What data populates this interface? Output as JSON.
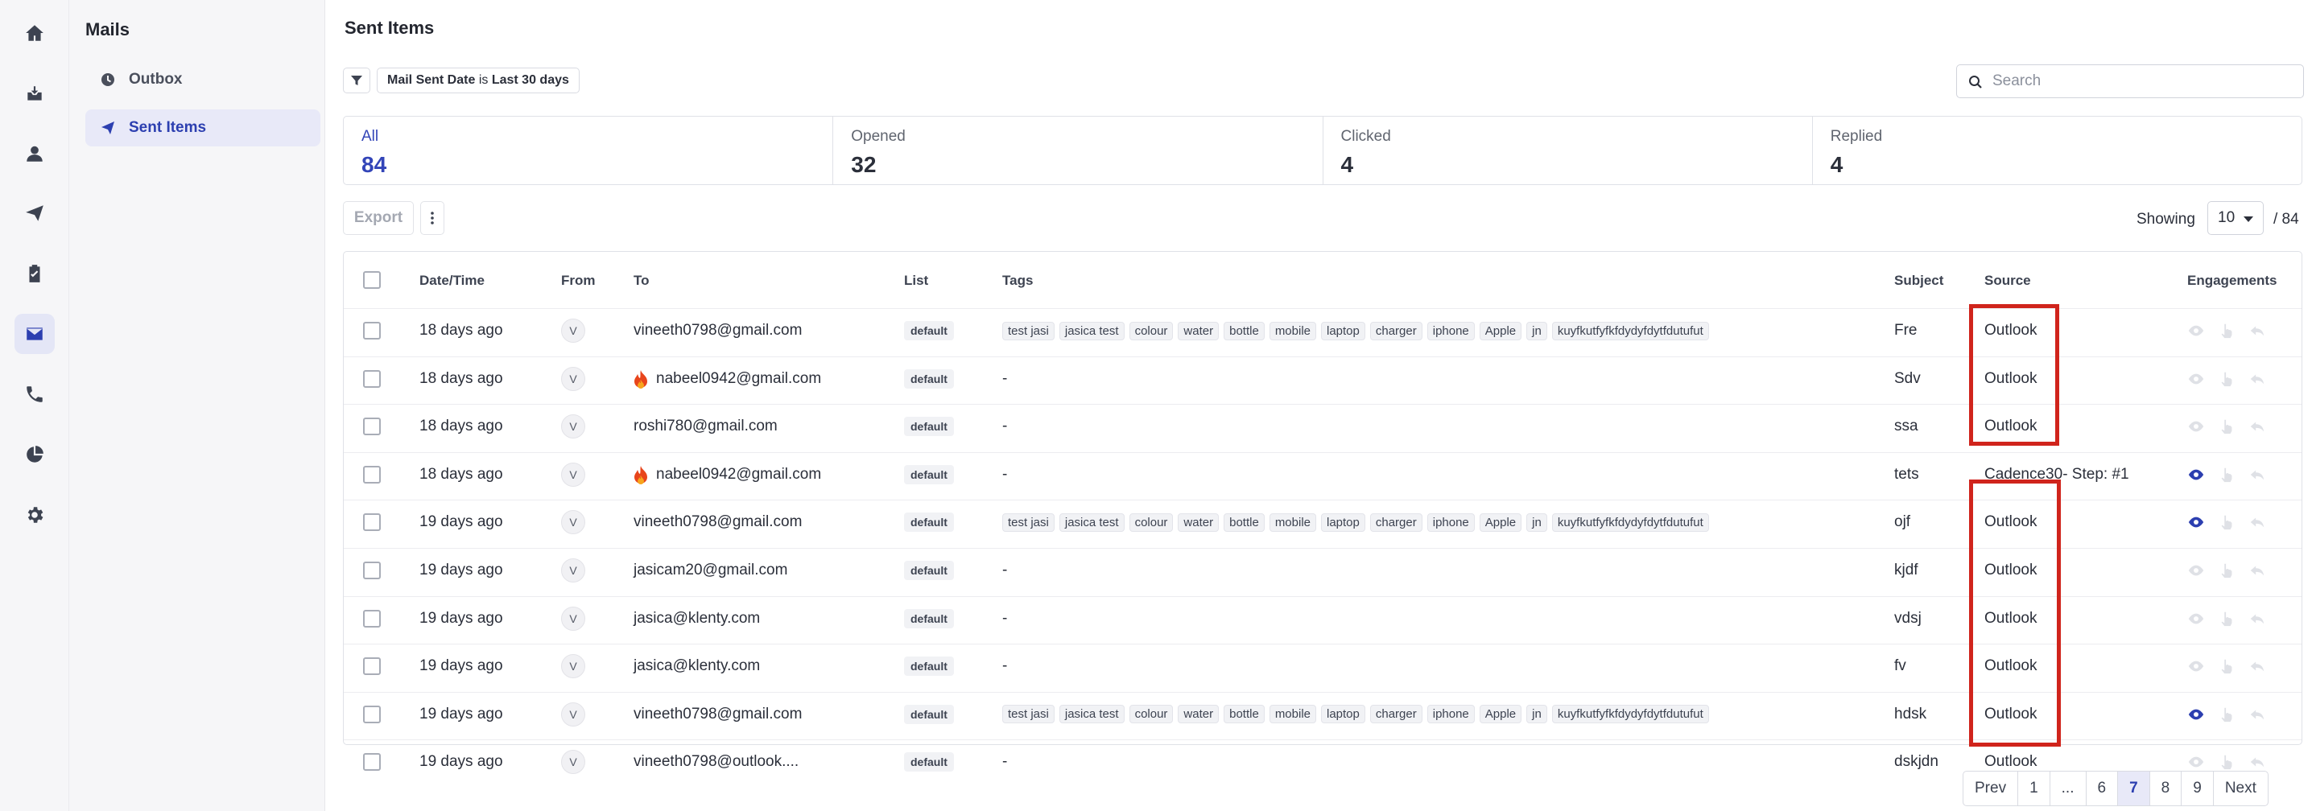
{
  "nav": {
    "icons": [
      "home-icon",
      "inbox-icon",
      "contacts-icon",
      "campaigns-icon",
      "tasks-icon",
      "mail-icon",
      "phone-icon",
      "reports-icon",
      "settings-icon"
    ],
    "active": "mail-icon"
  },
  "subnav": {
    "title": "Mails",
    "items": [
      {
        "label": "Outbox",
        "icon": "clock-icon"
      },
      {
        "label": "Sent Items",
        "icon": "send-icon"
      }
    ]
  },
  "page": {
    "title": "Sent Items"
  },
  "filter": {
    "field": "Mail Sent Date",
    "op": "is",
    "value": "Last 30 days"
  },
  "search": {
    "placeholder": "Search"
  },
  "stats": [
    {
      "label": "All",
      "value": "84"
    },
    {
      "label": "Opened",
      "value": "32"
    },
    {
      "label": "Clicked",
      "value": "4"
    },
    {
      "label": "Replied",
      "value": "4"
    }
  ],
  "toolbar": {
    "export_label": "Export",
    "showing_label": "Showing",
    "page_size": "10",
    "total": "/ 84"
  },
  "table": {
    "headers": [
      "Date/Time",
      "From",
      "To",
      "List",
      "Tags",
      "Subject",
      "Source",
      "Engagements"
    ],
    "tag_set": [
      "test jasi",
      "jasica test",
      "colour",
      "water",
      "bottle",
      "mobile",
      "laptop",
      "charger",
      "iphone",
      "Apple",
      "jn",
      "kuyfkutfyfkfdydyfdytfdutufut"
    ],
    "rows": [
      {
        "date": "18 days ago",
        "from": "V",
        "to": "vineeth0798@gmail.com",
        "fire": false,
        "list": "default",
        "tags": true,
        "no_tags": "",
        "subject": "Fre",
        "source": "Outlook",
        "opened": false
      },
      {
        "date": "18 days ago",
        "from": "V",
        "to": "nabeel0942@gmail.com",
        "fire": true,
        "list": "default",
        "tags": false,
        "no_tags": "-",
        "subject": "Sdv",
        "source": "Outlook",
        "opened": false
      },
      {
        "date": "18 days ago",
        "from": "V",
        "to": "roshi780@gmail.com",
        "fire": false,
        "list": "default",
        "tags": false,
        "no_tags": "-",
        "subject": "ssa",
        "source": "Outlook",
        "opened": false
      },
      {
        "date": "18 days ago",
        "from": "V",
        "to": "nabeel0942@gmail.com",
        "fire": true,
        "list": "default",
        "tags": false,
        "no_tags": "-",
        "subject": "tets",
        "source": "Cadence30- Step: #1",
        "opened": true
      },
      {
        "date": "19 days ago",
        "from": "V",
        "to": "vineeth0798@gmail.com",
        "fire": false,
        "list": "default",
        "tags": true,
        "no_tags": "",
        "subject": "ojf",
        "source": "Outlook",
        "opened": true
      },
      {
        "date": "19 days ago",
        "from": "V",
        "to": "jasicam20@gmail.com",
        "fire": false,
        "list": "default",
        "tags": false,
        "no_tags": "-",
        "subject": "kjdf",
        "source": "Outlook",
        "opened": false
      },
      {
        "date": "19 days ago",
        "from": "V",
        "to": "jasica@klenty.com",
        "fire": false,
        "list": "default",
        "tags": false,
        "no_tags": "-",
        "subject": "vdsj",
        "source": "Outlook",
        "opened": false
      },
      {
        "date": "19 days ago",
        "from": "V",
        "to": "jasica@klenty.com",
        "fire": false,
        "list": "default",
        "tags": false,
        "no_tags": "-",
        "subject": "fv",
        "source": "Outlook",
        "opened": false
      },
      {
        "date": "19 days ago",
        "from": "V",
        "to": "vineeth0798@gmail.com",
        "fire": false,
        "list": "default",
        "tags": true,
        "no_tags": "",
        "subject": "hdsk",
        "source": "Outlook",
        "opened": true
      },
      {
        "date": "19 days ago",
        "from": "V",
        "to": "vineeth0798@outlook....",
        "fire": false,
        "list": "default",
        "tags": false,
        "no_tags": "-",
        "subject": "dskjdn",
        "source": "Outlook",
        "opened": false
      }
    ]
  },
  "pagination": {
    "items": [
      "Prev",
      "1",
      "...",
      "6",
      "7",
      "8",
      "9",
      "Next"
    ],
    "current": "7"
  },
  "colors": {
    "accent": "#2c3fb0",
    "highlight_box": "#d0241c",
    "fire": "#e8451b"
  }
}
